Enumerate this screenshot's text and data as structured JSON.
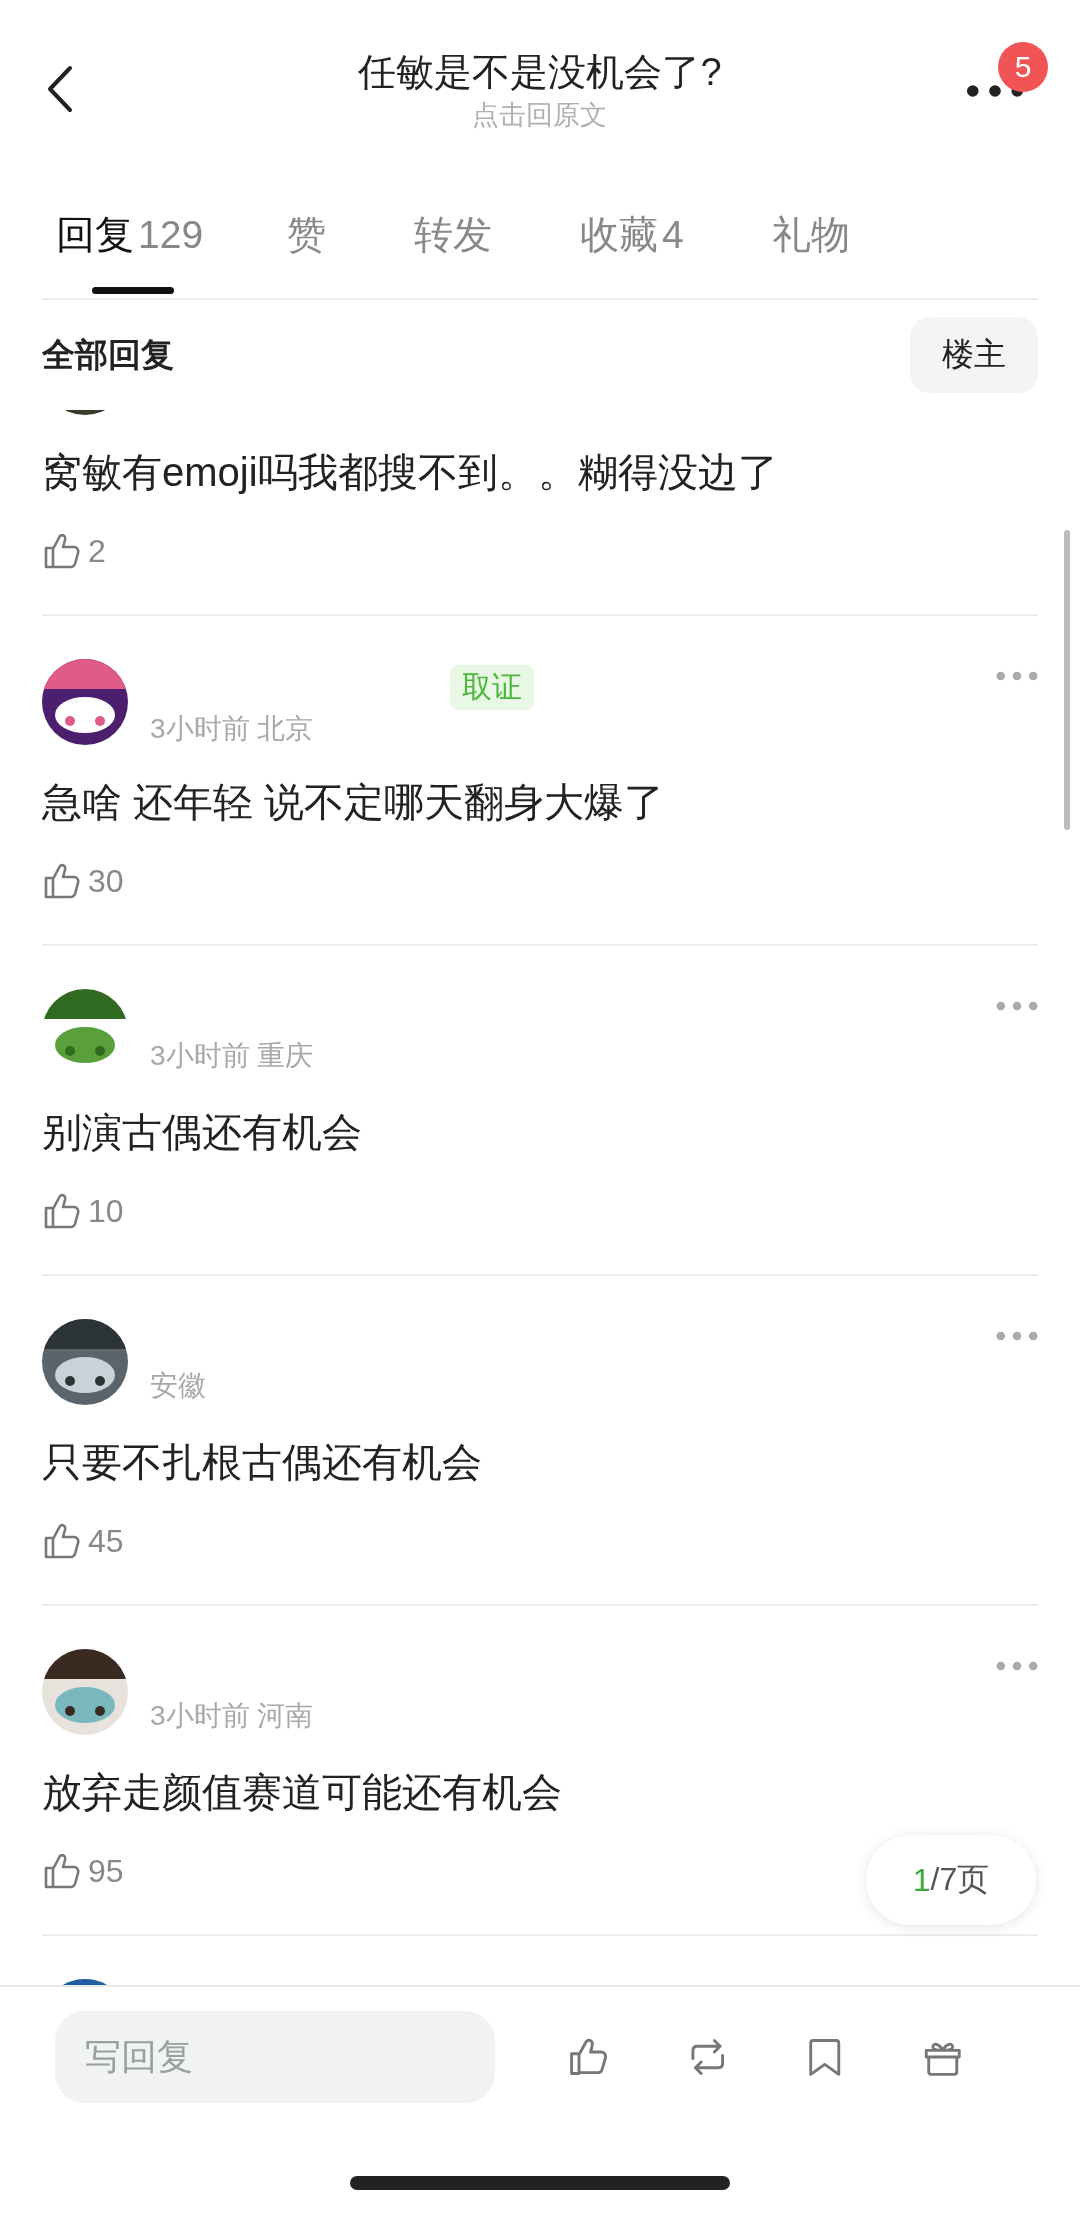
{
  "header": {
    "title": "任敏是不是没机会了?",
    "subtitle": "点击回原文",
    "badge": "5"
  },
  "tabs": [
    {
      "label": "回复",
      "count": "129",
      "selected": true
    },
    {
      "label": "赞",
      "selected": false
    },
    {
      "label": "转发",
      "selected": false
    },
    {
      "label": "收藏",
      "count": "4",
      "selected": false
    },
    {
      "label": "礼物",
      "selected": false
    }
  ],
  "filter": {
    "label": "全部回复",
    "button": "楼主"
  },
  "comments": [
    {
      "avatar": {
        "kind": "picture"
      },
      "text": "窝敏有emoji吗我都搜不到。。糊得没边了",
      "likes": "2"
    },
    {
      "avatar": {
        "kind": "picture"
      },
      "badge": "取证",
      "meta": "3小时前 北京",
      "text": "急啥 还年轻 说不定哪天翻身大爆了",
      "likes": "30"
    },
    {
      "avatar": {
        "kind": "picture"
      },
      "meta": "3小时前 重庆",
      "text": "别演古偶还有机会",
      "likes": "10"
    },
    {
      "avatar": {
        "kind": "picture"
      },
      "meta": "安徽",
      "text": "只要不扎根古偶还有机会",
      "likes": "45"
    },
    {
      "avatar": {
        "kind": "picture"
      },
      "meta": "3小时前 河南",
      "text": "放弃走颜值赛道可能还有机会",
      "likes": "95"
    },
    {
      "avatar": {
        "kind": "picture"
      }
    }
  ],
  "pager": {
    "current": "1",
    "total": "/7页"
  },
  "reply_bar": {
    "placeholder": "写回复"
  }
}
